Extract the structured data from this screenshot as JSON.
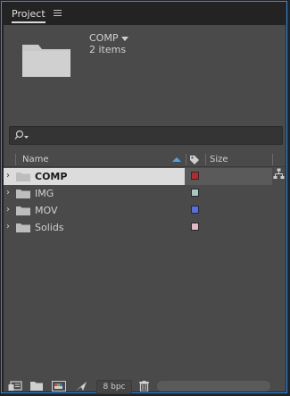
{
  "panel": {
    "title": "Project"
  },
  "preview": {
    "name": "COMP",
    "count": "2 items"
  },
  "search": {
    "placeholder": ""
  },
  "columns": {
    "name": "Name",
    "size": "Size"
  },
  "items": [
    {
      "name": "COMP",
      "color": "#b52a2a",
      "selected": true
    },
    {
      "name": "IMG",
      "color": "#a8c8c4",
      "selected": false
    },
    {
      "name": "MOV",
      "color": "#5a6ee0",
      "selected": false
    },
    {
      "name": "Solids",
      "color": "#e4b8c2",
      "selected": false
    }
  ],
  "footer": {
    "bpc_label": "8 bpc"
  }
}
